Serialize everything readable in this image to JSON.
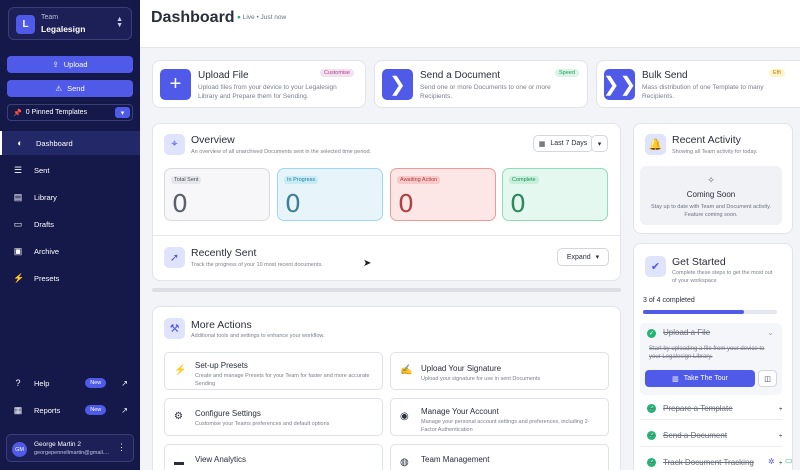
{
  "sidebar": {
    "team_label": "Team",
    "team_name": "Legalesign",
    "team_initial": "L",
    "upload_label": "Upload",
    "send_label": "Send",
    "pinned_label": "0 Pinned Templates",
    "nav": [
      {
        "label": "Dashboard",
        "icon": "dashboard-icon"
      },
      {
        "label": "Sent",
        "icon": "inbox-icon"
      },
      {
        "label": "Library",
        "icon": "library-icon"
      },
      {
        "label": "Drafts",
        "icon": "drafts-icon"
      },
      {
        "label": "Archive",
        "icon": "archive-icon"
      },
      {
        "label": "Presets",
        "icon": "lightning-icon"
      }
    ],
    "help_label": "Help",
    "reports_label": "Reports",
    "new_badge": "New",
    "user_initials": "GM",
    "user_name": "George Martin 2",
    "user_email": "georgepennellmartin@gmail...."
  },
  "header": {
    "title": "Dashboard",
    "live": "Live • Just now"
  },
  "tiles": [
    {
      "title": "Upload File",
      "desc": "Upload files from your device to your Legalesign Library and Prepare them for Sending.",
      "tag": "Customise"
    },
    {
      "title": "Send a Document",
      "desc": "Send one or more Documents to one or more Recipients.",
      "tag": "Speed"
    },
    {
      "title": "Bulk Send",
      "desc": "Mass distribution of one Template to many Recipients.",
      "tag": "Effi"
    }
  ],
  "overview": {
    "title": "Overview",
    "subtitle": "An overview of all unarchived Documents sent in the selected time period.",
    "period": "Last 7 Days",
    "stats": [
      {
        "label": "Total Sent",
        "value": "0"
      },
      {
        "label": "In Progress",
        "value": "0"
      },
      {
        "label": "Awaiting Action",
        "value": "0"
      },
      {
        "label": "Complete",
        "value": "0"
      }
    ]
  },
  "recent_sent": {
    "title": "Recently Sent",
    "subtitle": "Track the progress of your 10 most recent documents.",
    "expand": "Expand"
  },
  "more_actions": {
    "title": "More Actions",
    "subtitle": "Additional tools and settings to enhance your workflow.",
    "items": [
      {
        "title": "Set-up Presets",
        "desc": "Create and manage Presets for your Team for faster and more accurate Sending"
      },
      {
        "title": "Upload Your Signature",
        "desc": "Upload your signature for use in sent Documents"
      },
      {
        "title": "Configure Settings",
        "desc": "Customise your Teams preferences and default options"
      },
      {
        "title": "Manage Your Account",
        "desc": "Manage your personal account settings and preferences, including 2-Factor Authentication"
      },
      {
        "title": "View Analytics",
        "desc": ""
      },
      {
        "title": "Team Management",
        "desc": ""
      }
    ]
  },
  "activity": {
    "title": "Recent Activity",
    "subtitle": "Showing all Team activity for today.",
    "coming_title": "Coming Soon",
    "coming_desc": "Stay up to date with Team and Document activity. Feature coming soon."
  },
  "get_started": {
    "title": "Get Started",
    "subtitle": "Complete these steps to get the most out of your workspace",
    "progress_text": "3 of 4 completed",
    "progress": 0.75,
    "step1": "Upload a File",
    "step1_desc": "Start by uploading a file from your device to your Legalesign Library.",
    "tour": "Take The Tour",
    "steps": [
      "Prepare a Template",
      "Send a Document",
      "Track Document Tracking"
    ]
  },
  "colors": {
    "accent": "#4f5ae8",
    "sidebar": "#15194a",
    "success": "#22b573"
  }
}
